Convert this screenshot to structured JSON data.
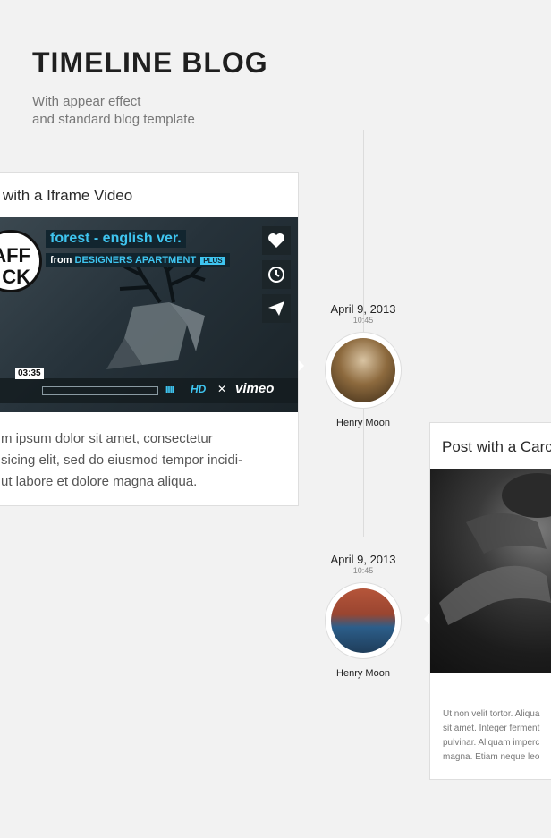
{
  "header": {
    "title": "TIMELINE BLOG",
    "subtitle_line1": "With appear effect",
    "subtitle_line2": "and standard blog template"
  },
  "posts": [
    {
      "title": "with a Iframe Video",
      "date": "April 9, 2013",
      "time": "10:45",
      "author": "Henry Moon",
      "video": {
        "title": "forest - english ver.",
        "from_label": "from",
        "channel": "DESIGNERS APARTMENT",
        "badge": "PLUS",
        "logo_text": "AFF\nCK",
        "timestamp": "03:35",
        "hd_label": "HD",
        "provider": "vimeo",
        "bars": "IIIII"
      },
      "excerpt": "m ipsum dolor sit amet, consectetur\nsicing elit, sed do eiusmod tempor incidi-\n ut labore et dolore magna aliqua."
    },
    {
      "title": "Post with a Carc",
      "date": "April 9, 2013",
      "time": "10:45",
      "author": "Henry Moon",
      "excerpt": "Ut non velit tortor. Aliqua\nsit amet. Integer ferment\npulvinar. Aliquam imperc\nmagna. Etiam neque leo"
    }
  ],
  "colors": {
    "background": "#f2f2f2",
    "accent": "#3fc5f0",
    "card": "#ffffff"
  }
}
